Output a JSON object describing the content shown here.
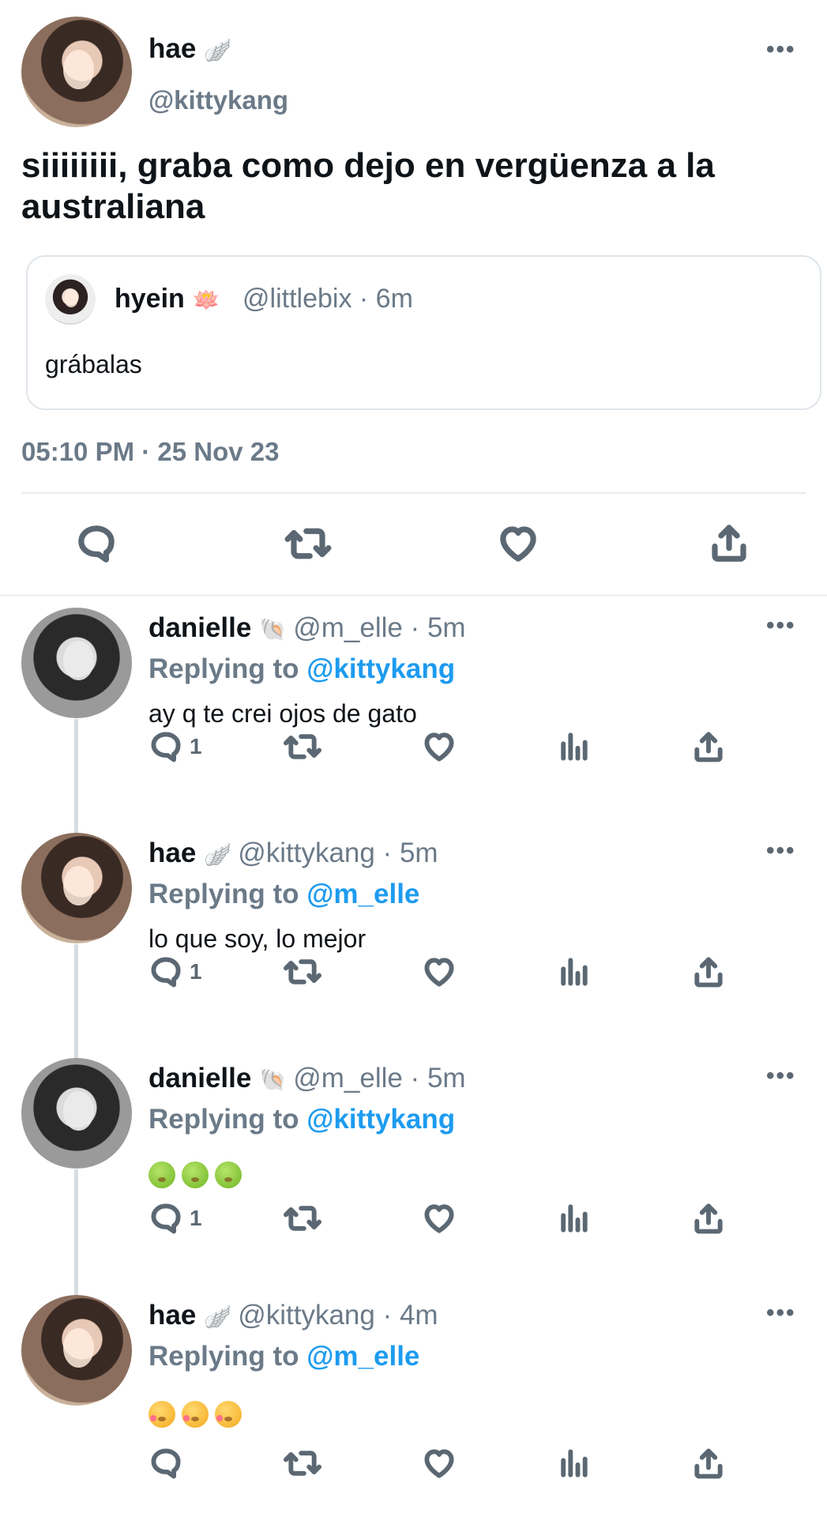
{
  "main_tweet": {
    "name": "hae",
    "name_emoji": "🪽",
    "handle": "@kittykang",
    "text": "siiiiiiii, graba como dejo en vergüenza a la australiana",
    "timestamp": "05:10 PM · 25 Nov 23",
    "quote": {
      "name": "hyein",
      "name_emoji": "🪷",
      "handle_time": "@littlebix · 6m",
      "text": "grábalas"
    }
  },
  "replies": [
    {
      "name": "danielle",
      "name_emoji": "🐚",
      "handle_time": "@m_elle · 5m",
      "replying_label": "Replying to",
      "replying_to": "@kittykang",
      "text": "ay q te crei ojos de gato",
      "reply_count": "1"
    },
    {
      "name": "hae",
      "name_emoji": "🪽",
      "handle_time": "@kittykang · 5m",
      "replying_label": "Replying to",
      "replying_to": "@m_elle",
      "text": "lo que soy, lo mejor",
      "reply_count": "1"
    },
    {
      "name": "danielle",
      "name_emoji": "🐚",
      "handle_time": "@m_elle · 5m",
      "replying_label": "Replying to",
      "replying_to": "@kittykang",
      "emoji_text": "🤢🤢🤢",
      "reply_count": "1"
    },
    {
      "name": "hae",
      "name_emoji": "🪽",
      "handle_time": "@kittykang · 4m",
      "replying_label": "Replying to",
      "replying_to": "@m_elle",
      "emoji_text": "😘😘😘",
      "reply_count": ""
    }
  ],
  "icons": {
    "more": "more-options-icon",
    "reply": "reply-icon",
    "retweet": "retweet-icon",
    "like": "like-icon",
    "views": "views-icon",
    "share": "share-icon"
  },
  "colors": {
    "link": "#1d9bf0",
    "muted": "#6b7a88",
    "text": "#0f1419"
  }
}
